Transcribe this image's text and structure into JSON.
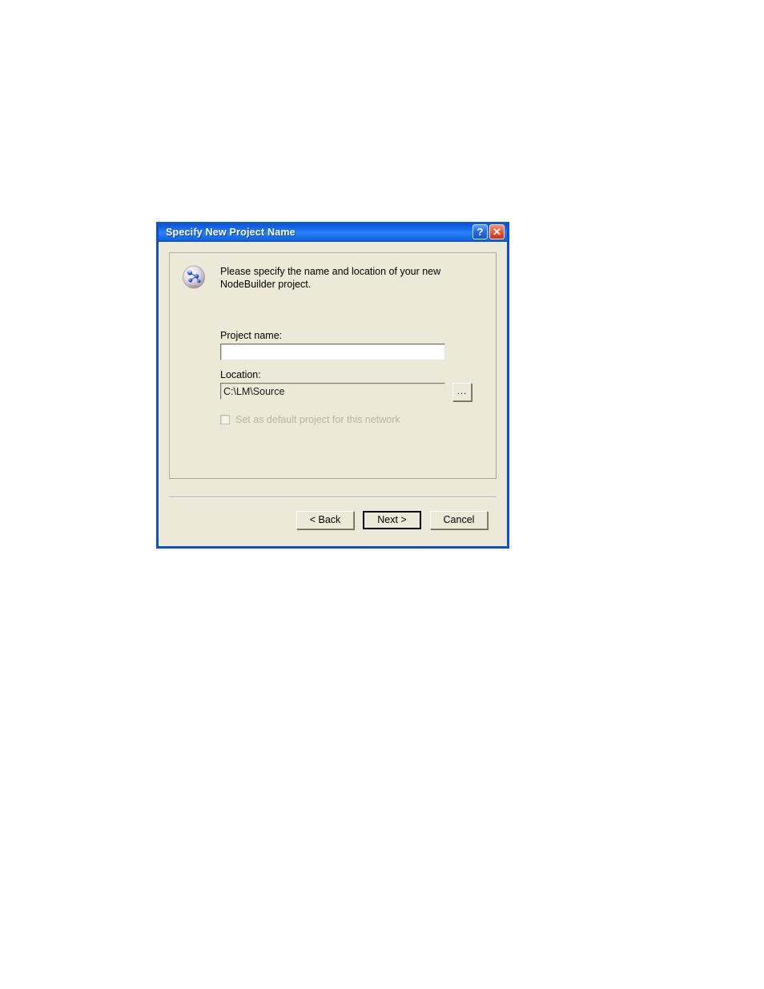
{
  "dialog": {
    "title": "Specify New Project Name",
    "titlebar_buttons": [
      {
        "name": "help",
        "glyph": "?"
      },
      {
        "name": "close",
        "glyph": "✕"
      }
    ],
    "accent_color": "#0a50d8",
    "face_color": "#ece9d8",
    "icon": "nodebuilder-sphere-icon",
    "intro_text": "Please specify the name and location of your new\nNodeBuilder project.",
    "fields": {
      "project_name": {
        "label": "Project name:",
        "value": "",
        "placeholder": ""
      },
      "location": {
        "label": "Location:",
        "value": "C:\\LM\\Source",
        "placeholder": "",
        "browse_label": "..."
      },
      "default_project": {
        "label": "Set as default project for this network",
        "checked": false,
        "enabled": false
      }
    },
    "buttons": {
      "back": "< Back",
      "next": "Next >",
      "cancel": "Cancel"
    }
  }
}
